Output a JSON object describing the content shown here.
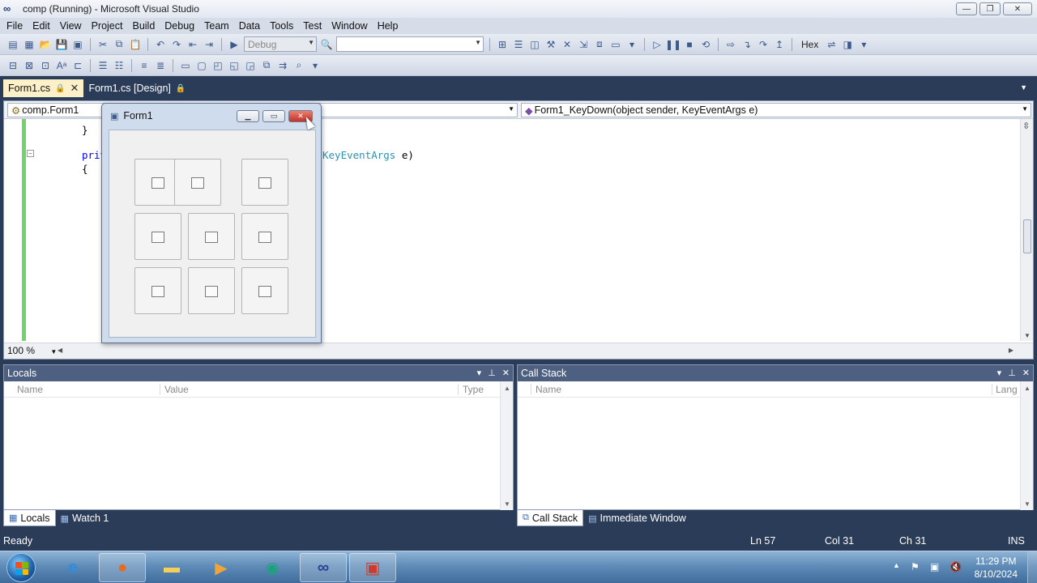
{
  "window": {
    "title": "comp (Running) - Microsoft Visual Studio",
    "minimize": "—",
    "restore": "❐",
    "close": "✕"
  },
  "menu": [
    "File",
    "Edit",
    "View",
    "Project",
    "Build",
    "Debug",
    "Team",
    "Data",
    "Tools",
    "Test",
    "Window",
    "Help"
  ],
  "toolbar": {
    "config_value": "Debug",
    "platform_value": "",
    "hex_label": "Hex"
  },
  "tabs": {
    "doc1": "Form1.cs",
    "doc2": "Form1.cs [Design]",
    "lock": "🔒",
    "close": "✕"
  },
  "editor": {
    "class_combo": "comp.Form1",
    "member_combo": "Form1_KeyDown(object sender, KeyEventArgs e)",
    "zoom": "100 %",
    "code": {
      "line1": "}",
      "line2_kw": "priv",
      "line2_type": "KeyEventArgs",
      "line2_rest": " e)",
      "line3": "{"
    }
  },
  "form1": {
    "title": "Form1",
    "minimize": "▁",
    "maximize": "▭",
    "close": "✕"
  },
  "locals": {
    "title": "Locals",
    "columns": [
      "Name",
      "Value",
      "Type"
    ],
    "ctrl_dropdown": "▾",
    "ctrl_pin": "⊥",
    "ctrl_close": "✕"
  },
  "callstack": {
    "title": "Call Stack",
    "columns": [
      "Name",
      "Lang"
    ]
  },
  "bottom_tabs": {
    "left": [
      "Locals",
      "Watch 1"
    ],
    "right": [
      "Call Stack",
      "Immediate Window"
    ]
  },
  "status": {
    "text": "Ready",
    "ln": "Ln 57",
    "col": "Col 31",
    "ch": "Ch 31",
    "mode": "INS"
  },
  "taskbar": {
    "time": "11:29 PM",
    "date": "8/10/2024"
  },
  "colors": {
    "vs_frame": "#2b3c59",
    "active_tab": "#fbf0c8",
    "keyword": "#0000ff",
    "type": "#2b91af",
    "change_bar": "#6fd46a"
  }
}
